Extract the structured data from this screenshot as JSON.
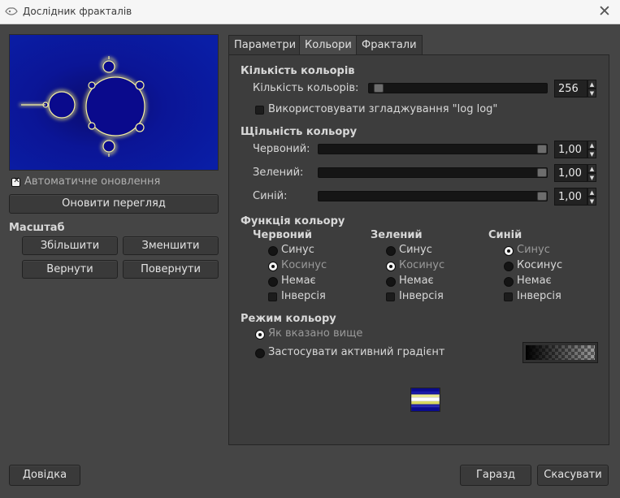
{
  "window": {
    "title": "Дослідник фракталів"
  },
  "preview": {
    "auto_update_label": "Автоматичне оновлення",
    "auto_update": true,
    "refresh_button": "Оновити перегляд"
  },
  "zoom": {
    "heading": "Масштаб",
    "zoom_in": "Збільшити",
    "zoom_out": "Зменшити",
    "undo": "Вернути",
    "redo": "Повернути"
  },
  "tabs": [
    "Параметри",
    "Кольори",
    "Фрактали"
  ],
  "active_tab": "Кольори",
  "num_colors": {
    "heading": "Кількість кольорів",
    "label": "Кількість кольорів:",
    "value": "256",
    "slider_fraction": 0.0,
    "loglog_label": "Використовувати згладжування \"log log\"",
    "loglog": false
  },
  "density": {
    "heading": "Щільність кольору",
    "channels": [
      {
        "label": "Червоний:",
        "value": "1,00",
        "fraction": 1.0
      },
      {
        "label": "Зелений:",
        "value": "1,00",
        "fraction": 1.0
      },
      {
        "label": "Синій:",
        "value": "1,00",
        "fraction": 1.0
      }
    ]
  },
  "function": {
    "heading": "Функція кольору",
    "columns": [
      {
        "title": "Червоний",
        "options": [
          "Синус",
          "Косинус",
          "Немає"
        ],
        "selected": "Косинус",
        "invert_label": "Інверсія",
        "invert": false
      },
      {
        "title": "Зелений",
        "options": [
          "Синус",
          "Косинус",
          "Немає"
        ],
        "selected": "Косинус",
        "invert_label": "Інверсія",
        "invert": false
      },
      {
        "title": "Синій",
        "options": [
          "Синус",
          "Косинус",
          "Немає"
        ],
        "selected": "Синус",
        "invert_label": "Інверсія",
        "invert": false
      }
    ]
  },
  "mode": {
    "heading": "Режим кольору",
    "as_specified": "Як вказано вище",
    "gradient": "Застосувати активний градієнт",
    "selected": "Як вказано вище"
  },
  "buttons": {
    "help": "Довідка",
    "ok": "Гаразд",
    "cancel": "Скасувати"
  },
  "colors": {
    "panel_bg": "#454545",
    "preview_blue": "#0a0a8c",
    "fractal_body": "#0a0a8c"
  }
}
